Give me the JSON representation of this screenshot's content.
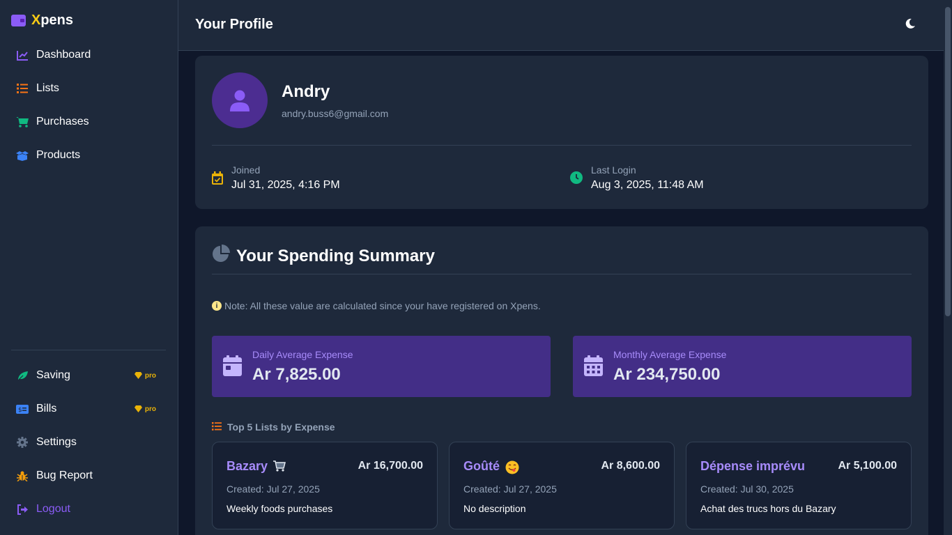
{
  "brand": {
    "first_letter": "X",
    "rest": "pens"
  },
  "sidebar": {
    "main_items": [
      {
        "label": "Dashboard",
        "icon": "chart-line-icon",
        "color": "#8b5cf6"
      },
      {
        "label": "Lists",
        "icon": "list-icon",
        "color": "#f97316"
      },
      {
        "label": "Purchases",
        "icon": "cart-icon",
        "color": "#10b981"
      },
      {
        "label": "Products",
        "icon": "boxes-icon",
        "color": "#3b82f6"
      }
    ],
    "bottom_items": [
      {
        "label": "Saving",
        "icon": "leaf-icon",
        "badge": "pro"
      },
      {
        "label": "Bills",
        "icon": "bill-icon",
        "badge": "pro"
      },
      {
        "label": "Settings",
        "icon": "gear-icon"
      },
      {
        "label": "Bug Report",
        "icon": "bug-icon"
      },
      {
        "label": "Logout",
        "icon": "logout-icon"
      }
    ]
  },
  "header": {
    "title": "Your Profile"
  },
  "profile": {
    "name": "Andry",
    "email": "andry.buss6@gmail.com",
    "joined_label": "Joined",
    "joined_value": "Jul 31, 2025, 4:16 PM",
    "last_login_label": "Last Login",
    "last_login_value": "Aug 3, 2025, 11:48 AM"
  },
  "summary": {
    "title": "Your Spending Summary",
    "note": "Note: All these value are calculated since your have registered on Xpens.",
    "daily_label": "Daily Average Expense",
    "daily_value": "Ar 7,825.00",
    "monthly_label": "Monthly Average Expense",
    "monthly_value": "Ar 234,750.00",
    "top_lists_title": "Top 5 Lists by Expense",
    "lists": [
      {
        "name": "Bazary",
        "emoji": "cart-emoji",
        "amount": "Ar 16,700.00",
        "created": "Created: Jul 27, 2025",
        "description": "Weekly foods purchases"
      },
      {
        "name": "Goûté",
        "emoji": "yum-emoji",
        "amount": "Ar 8,600.00",
        "created": "Created: Jul 27, 2025",
        "description": "No description"
      },
      {
        "name": "Dépense imprévu",
        "emoji": "",
        "amount": "Ar 5,100.00",
        "created": "Created: Jul 30, 2025",
        "description": "Achat des trucs hors du Bazary"
      }
    ]
  },
  "colors": {
    "accent": "#8b5cf6",
    "brand_x": "#facc15",
    "pro": "#eab308",
    "stat_bg": "#432e87"
  }
}
